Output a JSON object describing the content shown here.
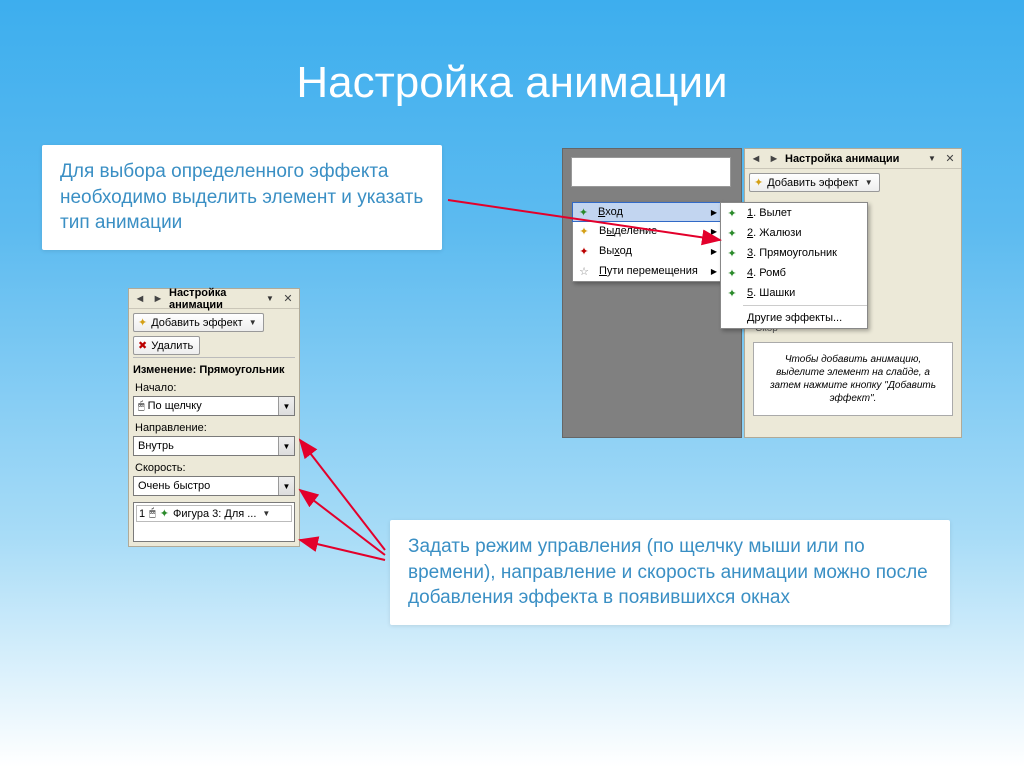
{
  "slide_title": "Настройка анимации",
  "callouts": {
    "top": "Для выбора определенного эффекта необходимо выделить элемент и указать тип анимации",
    "bottom": "Задать режим управления (по щелчку мыши или по времени), направление и скорость анимации можно после добавления эффекта в появившихся окнах"
  },
  "left_panel": {
    "header": "Настройка анимации",
    "add_effect": "Добавить эффект",
    "remove": "Удалить",
    "change_label": "Изменение: Прямоугольник",
    "start_label": "Начало:",
    "start_value": "По щелчку",
    "direction_label": "Направление:",
    "direction_value": "Внутрь",
    "speed_label": "Скорость:",
    "speed_value": "Очень быстро",
    "list_item": "Фигура 3: Для ..."
  },
  "right_panel": {
    "header": "Настройка анимации",
    "add_effect": "Добавить эффект",
    "skor": "Скор",
    "tip": "Чтобы добавить анимацию, выделите элемент на слайде, а затем нажмите кнопку \"Добавить эффект\"."
  },
  "menu1": {
    "items": [
      "Вход",
      "Выделение",
      "Выход",
      "Пути перемещения"
    ]
  },
  "menu2": {
    "items": [
      "Вылет",
      "Жалюзи",
      "Прямоугольник",
      "Ромб",
      "Шашки"
    ],
    "more": "Другие эффекты..."
  }
}
